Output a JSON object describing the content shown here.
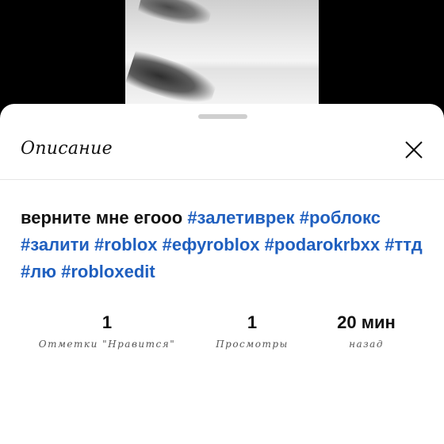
{
  "sheet": {
    "title": "Описание",
    "close_icon": "close-icon"
  },
  "caption": {
    "text": "верните мне егооо",
    "hashtags": [
      "#залетиврек",
      "#роблокс",
      "#залити",
      "#roblox",
      "#ефуroblox",
      "#podarokrbxx",
      "#ттд",
      "#лю",
      "#robloxedit"
    ]
  },
  "stats": {
    "likes": {
      "value": "1",
      "label": "Отметки \"Нравится\""
    },
    "views": {
      "value": "1",
      "label": "Просмотры"
    },
    "time": {
      "value": "20 мин",
      "label": "назад"
    }
  },
  "colors": {
    "hashtag": "#1f5fbf",
    "backdrop": "#000000",
    "sheet": "#ffffff"
  }
}
